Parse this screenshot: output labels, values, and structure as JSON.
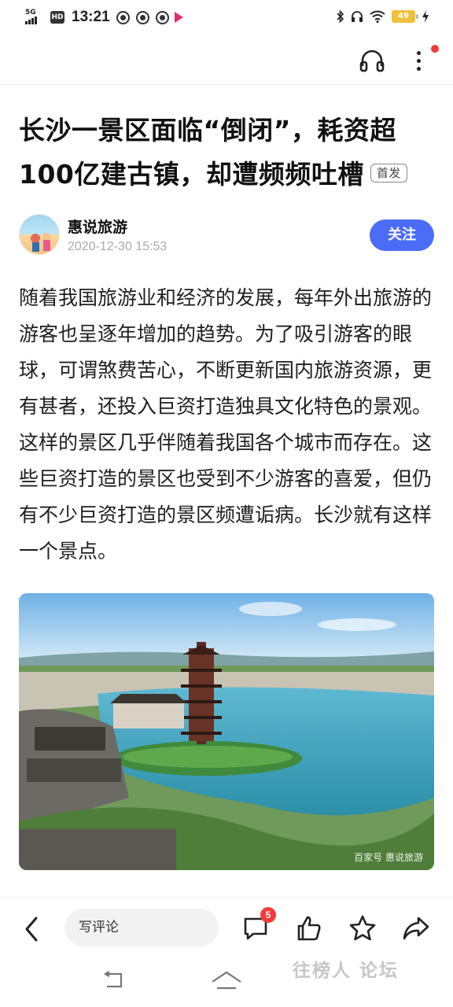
{
  "status_bar": {
    "network": "5G",
    "hd": "HD",
    "time": "13:21",
    "battery": "49"
  },
  "toolbar": {
    "listen_icon": "headset-icon",
    "more_icon": "more-vertical-icon"
  },
  "article": {
    "title": "长沙一景区面临“倒闭”，耗资超100亿建古镇，却遭频频吐槽",
    "badge": "首发",
    "author": {
      "name": "惠说旅游",
      "date": "2020-12-30 15:53",
      "follow_label": "关注"
    },
    "body": "随着我国旅游业和经济的发展，每年外出旅游的游客也呈逐年增加的趋势。为了吸引游客的眼球，可谓煞费苦心，不断更新国内旅游资源，更有甚者，还投入巨资打造独具文化特色的景观。这样的景区几乎伴随着我国各个城市而存在。这些巨资打造的景区也受到不少游客的喜爱，但仍有不少巨资打造的景区频遭诟病。长沙就有这样一个景点。",
    "photo_credit": "百家号 惠说旅游"
  },
  "action_bar": {
    "comment_placeholder": "写评论",
    "comment_count": "5",
    "icons": [
      "back-icon",
      "comment-icon",
      "like-icon",
      "favorite-icon",
      "share-icon"
    ]
  },
  "watermark": "往榜人 论坛",
  "colors": {
    "accent": "#4a6cf7",
    "badge_red": "#f23b3b"
  }
}
